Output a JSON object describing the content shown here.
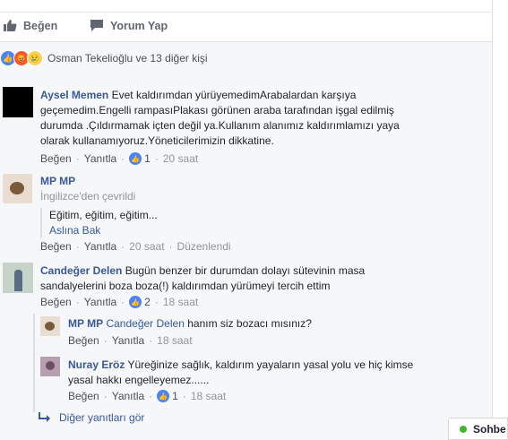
{
  "actions": {
    "like": "Beğen",
    "comment": "Yorum Yap"
  },
  "reactions": {
    "text": "Osman Tekelioğlu ve 13 diğer kişi"
  },
  "comments": [
    {
      "name": "Aysel Memen",
      "lines": [
        "Evet kaldırımdan yürüyemedimArabalardan karşıya",
        "geçemedim.Engelli rampasıPlakası görünen araba tarafından işgal edilmiş",
        "durumda .Çıldırmamak içten değil ya.Kullanım alanımız kaldırımlamızı yaya",
        "olarak kullanamıyoruz.Yöneticilerimizin dikkatine."
      ],
      "like": "Beğen",
      "reply": "Yanıtla",
      "likes": "1",
      "time": "20 saat"
    },
    {
      "name": "MP MP",
      "translated": "İngilizce'den çevrildi",
      "text": "Eğitim, eğitim, eğitim...",
      "see_original": "Aslına Bak",
      "like": "Beğen",
      "reply": "Yanıtla",
      "time": "20 saat",
      "edited": "Düzenlendi"
    },
    {
      "name": "Candeğer Delen",
      "lines": [
        "Bugün benzer bir durumdan dolayı sütevinin masa",
        "sandalyelerini boza boza(!) kaldırımdan yürümeyi tercih ettim"
      ],
      "like": "Beğen",
      "reply": "Yanıtla",
      "likes": "2",
      "time": "18 saat"
    }
  ],
  "replies": [
    {
      "name": "MP MP",
      "mention": "Candeğer Delen",
      "text": "hanım siz bozacı mısınız?",
      "like": "Beğen",
      "reply": "Yanıtla",
      "time": "18 saat"
    },
    {
      "name": "Nuray Eröz",
      "lines": [
        "Yüreğinize sağlık, kaldırım yayaların yasal yolu ve hiç kimse",
        "yasal hakkı engelleyemez......"
      ],
      "like": "Beğen",
      "reply": "Yanıtla",
      "likes": "1",
      "time": "18 saat"
    }
  ],
  "more_replies": "Diğer yanıtları gör",
  "chat": {
    "label": "Sohbe"
  },
  "colors": {
    "link": "#385898",
    "like_blue": "#4c82f7",
    "online": "#42b72a"
  }
}
